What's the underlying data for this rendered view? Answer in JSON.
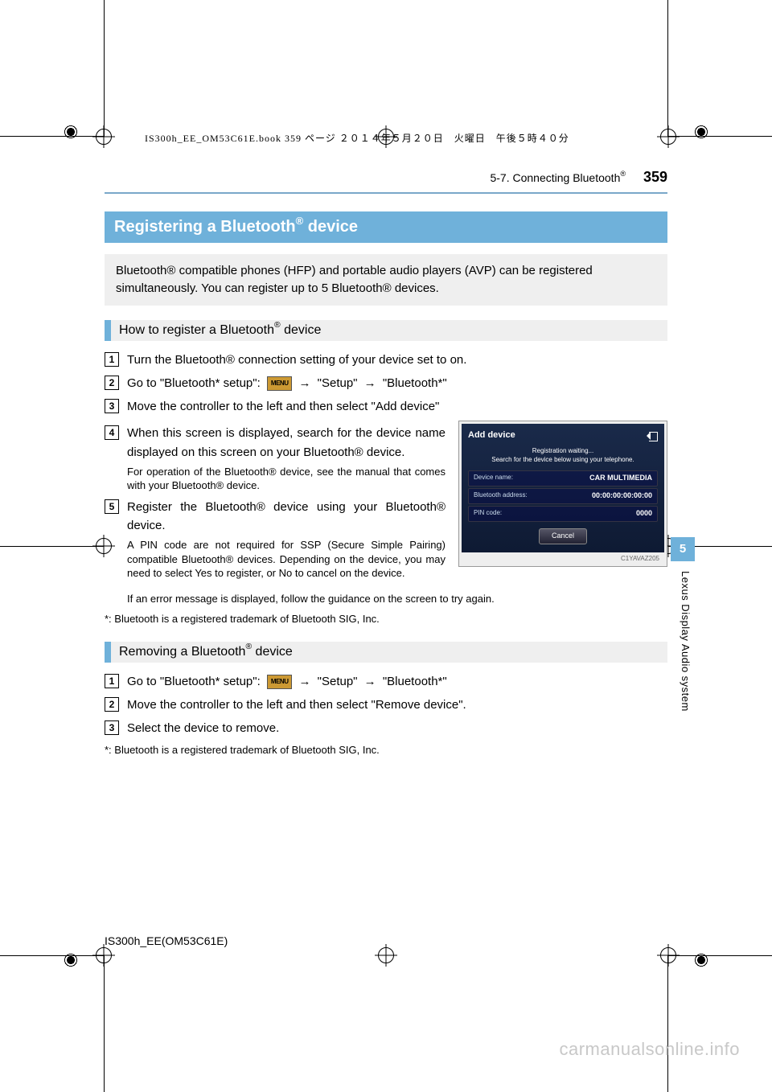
{
  "print_note": "IS300h_EE_OM53C61E.book  359 ページ  ２０１４年５月２０日　火曜日　午後５時４０分",
  "header": {
    "section": "5-7. Connecting Bluetooth",
    "page_number": "359"
  },
  "title": {
    "prefix": "Registering a Bluetooth",
    "suffix": " device"
  },
  "lead": "Bluetooth® compatible phones (HFP) and portable audio players (AVP) can be registered simultaneously. You can register up to 5 Bluetooth® devices.",
  "section1": {
    "heading_prefix": "How to register a Bluetooth",
    "heading_suffix": " device",
    "step1": "Turn the Bluetooth® connection setting of your device set to on.",
    "step2_a": "Go to \"Bluetooth* setup\": ",
    "step2_menu": "MENU",
    "step2_b": " \"Setup\" ",
    "step2_c": " \"Bluetooth*\"",
    "step3": "Move the controller to the left and then select \"Add device\"",
    "step4": "When this screen is displayed, search for the device name displayed on this screen on your Bluetooth® device.",
    "step4_note": "For operation of the Bluetooth® device, see the manual that comes with your Bluetooth® device.",
    "step5": "Register the Bluetooth® device using your Bluetooth® device.",
    "step5_note": "A PIN code are not required for SSP (Secure Simple Pairing) compatible Bluetooth® devices. Depending on the device, you may need to select Yes to register, or No to cancel on the device.",
    "error_line": "If an error message is displayed, follow the guidance on the screen to try again.",
    "footnote": "*: Bluetooth is a registered trademark of Bluetooth SIG, Inc."
  },
  "device_shot": {
    "title": "Add device",
    "msg_line1": "Registration waiting...",
    "msg_line2": "Search for the device below using your telephone.",
    "row1_label": "Device name:",
    "row1_value": "CAR MULTIMEDIA",
    "row2_label": "Bluetooth address:",
    "row2_value": "00:00:00:00:00:00",
    "row3_label": "PIN code:",
    "row3_value": "0000",
    "cancel": "Cancel",
    "caption": "C1YAVAZ205"
  },
  "section2": {
    "heading_prefix": "Removing a Bluetooth",
    "heading_suffix": " device",
    "step1_a": "Go to \"Bluetooth* setup\": ",
    "step1_menu": "MENU",
    "step1_b": " \"Setup\" ",
    "step1_c": " \"Bluetooth*\"",
    "step2": "Move the controller to the left and then select \"Remove device\".",
    "step3": "Select the device to remove.",
    "footnote": "*: Bluetooth is a registered trademark of Bluetooth SIG, Inc."
  },
  "chapter_tab": "5",
  "vert_label": "Lexus Display Audio system",
  "manual_id": "IS300h_EE(OM53C61E)",
  "watermark": "carmanualsonline.info",
  "arrow": "→"
}
